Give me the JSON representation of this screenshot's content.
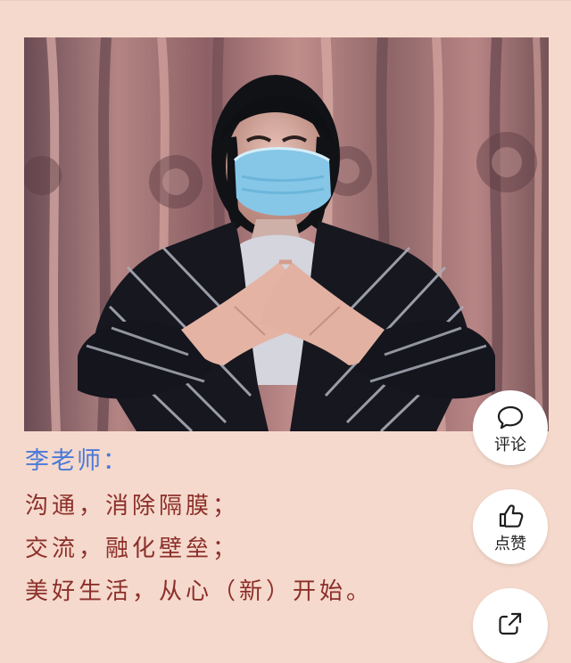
{
  "post": {
    "author_label": "李老师：",
    "lines": [
      "沟通，消除隔膜；",
      "交流，融化壁垒；",
      "美好生活，从心（新）开始。"
    ]
  },
  "photo": {
    "alt": "",
    "dominant_colors": {
      "curtain": "#9b6f70",
      "curtain_fold": "#c99b95",
      "mask": "#7ec4e4",
      "jacket": "#15151d",
      "stripe": "#a7a7ae"
    }
  },
  "actions": {
    "comment_label": "评论",
    "like_label": "点赞",
    "share_label": "",
    "comment_icon": "comment-icon",
    "like_icon": "thumbs-up-icon",
    "share_icon": "share-icon"
  }
}
